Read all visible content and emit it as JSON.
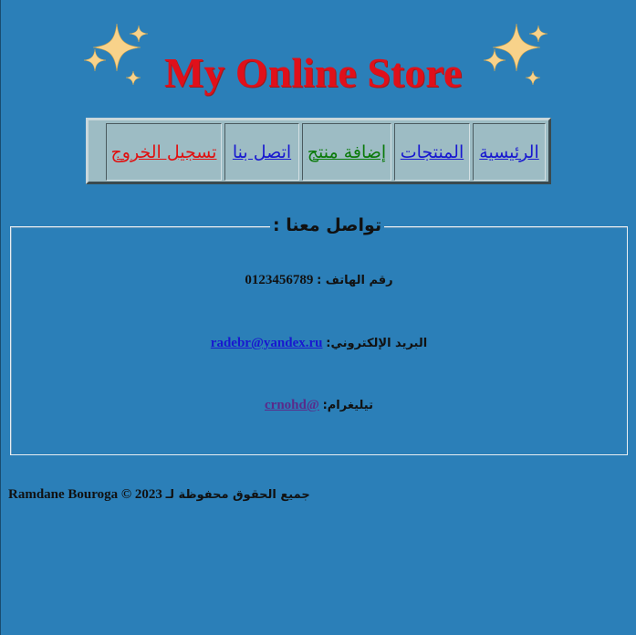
{
  "header": {
    "title": "My Online Store",
    "sparkle_color": "#f8d28a"
  },
  "nav": {
    "items": [
      {
        "label": "الرئيسية",
        "color": "#1818d0"
      },
      {
        "label": "المنتجات",
        "color": "#1818d0"
      },
      {
        "label": "إضافة منتج",
        "color": "#0a7a0a"
      },
      {
        "label": "اتصل بنا",
        "color": "#1818d0"
      },
      {
        "label": "تسجيل الخروج",
        "color": "#e01010"
      }
    ]
  },
  "contact": {
    "legend": "تواصل معنا :",
    "phone_label": "رقم الهاتف :",
    "phone_value": "0123456789",
    "email_label": "البريد الإلكتروني:",
    "email_value": "radebr@yandex.ru",
    "telegram_label": "تيليغرام:",
    "telegram_value": "@crnohd"
  },
  "footer": {
    "rights_text": "جميع الحقوق محفوظة لـ",
    "year": "2023",
    "copyright_symbol": "©",
    "author": "Ramdane Bouroga"
  },
  "colors": {
    "background": "#2b7fb8",
    "title": "#e0101a",
    "nav_bg": "#9dbcc4"
  }
}
